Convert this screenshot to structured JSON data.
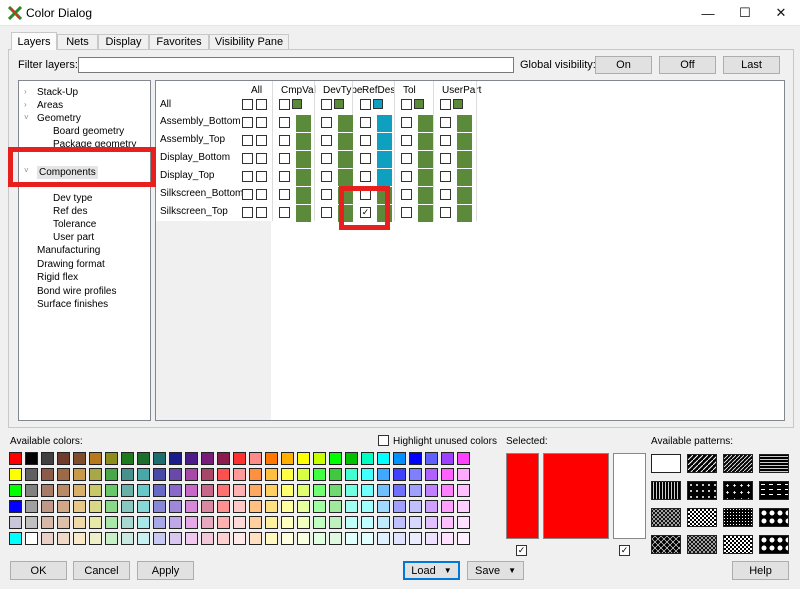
{
  "window": {
    "title": "Color Dialog",
    "minimize": "—",
    "maximize": "☐",
    "close": "✕"
  },
  "tabs": [
    "Layers",
    "Nets",
    "Display",
    "Favorites",
    "Visibility Pane"
  ],
  "filter": {
    "label": "Filter layers:",
    "value": "",
    "global_label": "Global visibility:",
    "buttons": [
      "On",
      "Off",
      "Last"
    ]
  },
  "tree": [
    {
      "label": "Stack-Up",
      "arrow": "›"
    },
    {
      "label": "Areas",
      "arrow": "›"
    },
    {
      "label": "Geometry",
      "arrow": "˅"
    },
    {
      "label": "Board geometry",
      "arrow": ""
    },
    {
      "label": "Package geometry",
      "arrow": ""
    },
    {
      "label": "Components",
      "arrow": "˅"
    },
    {
      "label": "Dev type",
      "arrow": ""
    },
    {
      "label": "Ref des",
      "arrow": ""
    },
    {
      "label": "Tolerance",
      "arrow": ""
    },
    {
      "label": "User part",
      "arrow": ""
    },
    {
      "label": "Manufacturing",
      "arrow": ""
    },
    {
      "label": "Drawing format",
      "arrow": ""
    },
    {
      "label": "Rigid flex",
      "arrow": ""
    },
    {
      "label": "Bond wire profiles",
      "arrow": ""
    },
    {
      "label": "Surface finishes",
      "arrow": ""
    }
  ],
  "grid": {
    "col_all": "All",
    "columns": [
      "CmpVal",
      "DevType",
      "RefDes",
      "Tol",
      "UserPart"
    ],
    "row_all": "All",
    "rows": [
      "Assembly_Bottom",
      "Assembly_Top",
      "Display_Bottom",
      "Display_Top",
      "Silkscreen_Bottom",
      "Silkscreen_Top"
    ],
    "checked_cell": {
      "row": "Silkscreen_Top",
      "column": "RefDes"
    },
    "column_colors": [
      "#5b8a3a",
      "#5b8a3a",
      "#0f9fbf",
      "#5b8a3a",
      "#5b8a3a"
    ],
    "column_colors_rows": [
      [
        "#5b8a3a",
        "#5b8a3a",
        "#5b8a3a",
        "#5b8a3a",
        "#5b8a3a",
        "#5b8a3a"
      ],
      [
        "#5b8a3a",
        "#5b8a3a",
        "#5b8a3a",
        "#5b8a3a",
        "#5b8a3a",
        "#5b8a3a"
      ],
      [
        "#0f9fbf",
        "#0f9fbf",
        "#0f9fbf",
        "#0f9fbf",
        "#5b8a3a",
        "#5b8a3a"
      ],
      [
        "#5b8a3a",
        "#5b8a3a",
        "#5b8a3a",
        "#5b8a3a",
        "#5b8a3a",
        "#5b8a3a"
      ],
      [
        "#5b8a3a",
        "#5b8a3a",
        "#5b8a3a",
        "#5b8a3a",
        "#5b8a3a",
        "#5b8a3a"
      ]
    ]
  },
  "colors": {
    "label": "Available colors:",
    "highlight_unused": "Highlight unused colors",
    "palette": [
      [
        "#ff0000",
        "#000000",
        "#404040",
        "#6e3b2c",
        "#7f4d2c",
        "#b8781c",
        "#8c8c1c",
        "#1c7a1c",
        "#1c6e2c",
        "#1c6e6e",
        "#1c1c8c",
        "#4c1c8c",
        "#7a1c7a",
        "#8c1c4c",
        "#ff3030",
        "#ff8a8a",
        "#ff7700",
        "#ffb000",
        "#ffff00",
        "#c8ff00",
        "#00ff00",
        "#00c000",
        "#00ffc0",
        "#00ffff",
        "#0090ff",
        "#0000ff",
        "#6060ff",
        "#a040ff",
        "#ff40ff"
      ],
      [
        "#ffff00",
        "#606060",
        "#8c5a48",
        "#9c6a48",
        "#c89a48",
        "#a8a848",
        "#48a848",
        "#48908c",
        "#48a8a8",
        "#4848a8",
        "#6848a8",
        "#a848a8",
        "#a84868",
        "#ff5050",
        "#ff9a9a",
        "#ff9040",
        "#ffc040",
        "#ffff40",
        "#d8ff40",
        "#40ff40",
        "#40c840",
        "#40ffd0",
        "#40ffff",
        "#40a8ff",
        "#4040ff",
        "#8080ff",
        "#b060ff",
        "#ff60ff",
        "#ffaaff"
      ],
      [
        "#00ff00",
        "#808080",
        "#a87a68",
        "#b88a68",
        "#d8b068",
        "#c8c868",
        "#68c868",
        "#68b0a8",
        "#68c8c8",
        "#6868c8",
        "#8868c8",
        "#c868c8",
        "#c86888",
        "#ff7070",
        "#ffb0b0",
        "#ffa860",
        "#ffd060",
        "#ffff70",
        "#e0ff70",
        "#70ff70",
        "#70d870",
        "#70ffe0",
        "#70ffff",
        "#70c0ff",
        "#7070ff",
        "#a0a0ff",
        "#c080ff",
        "#ff80ff",
        "#ffc0ff"
      ],
      [
        "#0000ff",
        "#a0a0a0",
        "#c09888",
        "#d0a888",
        "#e8c888",
        "#d8d888",
        "#88d888",
        "#88c8c0",
        "#88d8d8",
        "#8888d8",
        "#a088d8",
        "#d888d8",
        "#d888a0",
        "#ff9090",
        "#ffc8c8",
        "#ffc080",
        "#ffe080",
        "#ffffa0",
        "#e8ffa0",
        "#a0ffa0",
        "#a0e8a0",
        "#a0fff0",
        "#a0ffff",
        "#a0d8ff",
        "#a0a0ff",
        "#c0c0ff",
        "#d0a0ff",
        "#ffa0ff",
        "#ffd0ff"
      ],
      [
        "#c8c8d8",
        "#c0c0c0",
        "#d8b8a8",
        "#e0c0a8",
        "#f0d8a8",
        "#e8e8a8",
        "#a8e8a8",
        "#a8d8d0",
        "#a8e8e8",
        "#a8a8e8",
        "#c0a8e8",
        "#e8a8e8",
        "#e8a8c0",
        "#ffb0b0",
        "#ffd8d8",
        "#ffd0a0",
        "#fff0a0",
        "#ffffc0",
        "#f0ffc0",
        "#c0ffc0",
        "#c0f0c0",
        "#c0fff8",
        "#c0ffff",
        "#c0e8ff",
        "#c0c0ff",
        "#d8d8ff",
        "#e0c0ff",
        "#ffc0ff",
        "#ffe0ff"
      ],
      [
        "#00ffff",
        "#ffffff",
        "#e8d0c8",
        "#f0d8c8",
        "#f8e8c8",
        "#f0f0c8",
        "#c8f0c8",
        "#c8e8e0",
        "#c8f0f0",
        "#c8c8f0",
        "#d8c8f0",
        "#f0c8f0",
        "#f0c8d8",
        "#ffd0d0",
        "#ffe8e8",
        "#ffe0c0",
        "#fff8c0",
        "#ffffe0",
        "#f8ffe0",
        "#e0ffe0",
        "#e0f8e0",
        "#e0fffc",
        "#e0ffff",
        "#e0f0ff",
        "#e0e0ff",
        "#ececff",
        "#f0e0ff",
        "#ffe0ff",
        "#fff0ff"
      ]
    ]
  },
  "selected": {
    "label": "Selected:",
    "color_1": "#ff0000",
    "color_2": "#ff0000",
    "color_3": "#ffffff"
  },
  "patterns": {
    "label": "Available patterns:"
  },
  "buttons": {
    "ok": "OK",
    "cancel": "Cancel",
    "apply": "Apply",
    "load": "Load",
    "save": "Save",
    "help": "Help"
  },
  "accent": "#e8201d"
}
